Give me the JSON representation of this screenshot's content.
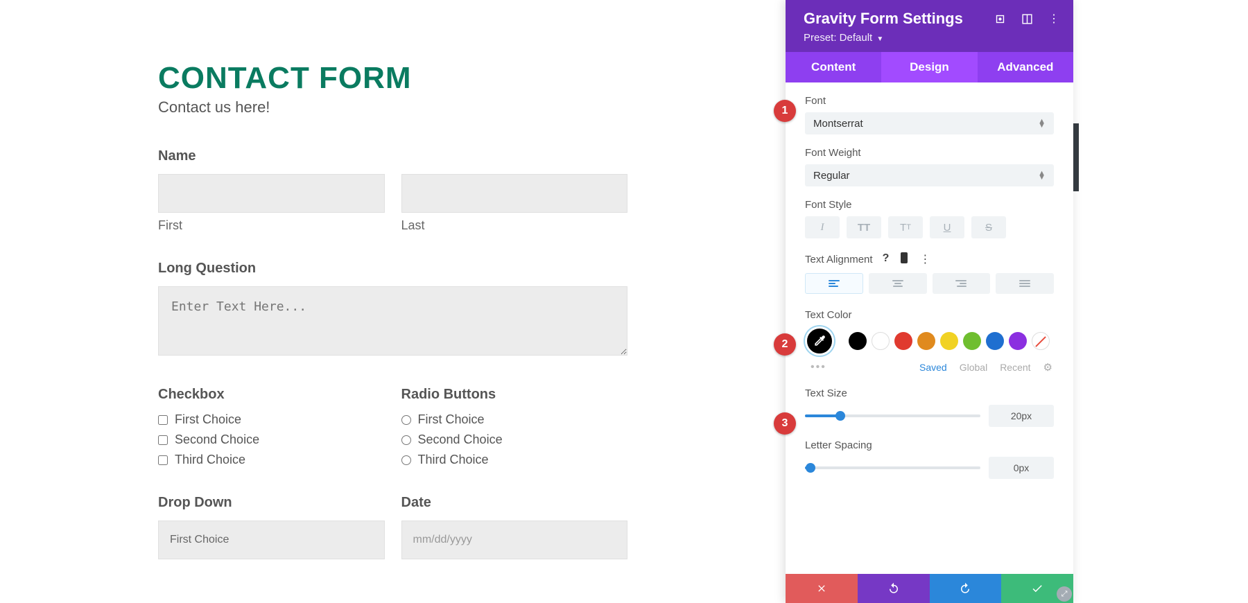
{
  "form": {
    "title": "CONTACT FORM",
    "subtitle": "Contact us here!",
    "name_label": "Name",
    "first_label": "First",
    "last_label": "Last",
    "long_q_label": "Long Question",
    "long_q_placeholder": "Enter Text Here...",
    "checkbox_label": "Checkbox",
    "radio_label": "Radio Buttons",
    "choices": [
      "First Choice",
      "Second Choice",
      "Third Choice"
    ],
    "dropdown_label": "Drop Down",
    "dropdown_value": "First Choice",
    "date_label": "Date",
    "date_placeholder": "mm/dd/yyyy"
  },
  "panel": {
    "title": "Gravity Form Settings",
    "preset_label": "Preset: Default",
    "tabs": {
      "content": "Content",
      "design": "Design",
      "advanced": "Advanced"
    },
    "font_label": "Font",
    "font_value": "Montserrat",
    "font_weight_label": "Font Weight",
    "font_weight_value": "Regular",
    "font_style_label": "Font Style",
    "text_align_label": "Text Alignment",
    "text_color_label": "Text Color",
    "saved_tabs": {
      "saved": "Saved",
      "global": "Global",
      "recent": "Recent"
    },
    "text_size_label": "Text Size",
    "text_size_value": "20px",
    "letter_spacing_label": "Letter Spacing",
    "letter_spacing_value": "0px",
    "swatches": [
      "#000000",
      "#ffffff",
      "#e03a2f",
      "#e08a1e",
      "#f1d223",
      "#6fbe2f",
      "#1f6fd0",
      "#8b2fe0"
    ]
  },
  "badges": {
    "b1": "1",
    "b2": "2",
    "b3": "3"
  }
}
